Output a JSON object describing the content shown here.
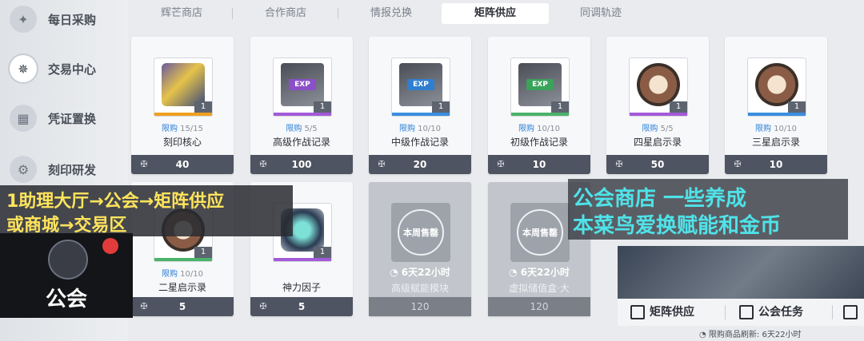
{
  "sidebar": {
    "items": [
      {
        "label": "每日采购",
        "icon": "cart-icon",
        "active": false
      },
      {
        "label": "交易中心",
        "icon": "star-compass-icon",
        "active": true
      },
      {
        "label": "凭证置换",
        "icon": "voucher-icon",
        "active": false
      },
      {
        "label": "刻印研发",
        "icon": "gear-icon",
        "active": false
      }
    ]
  },
  "tabs": [
    {
      "label": "辉芒商店",
      "active": false
    },
    {
      "label": "合作商店",
      "active": false
    },
    {
      "label": "情报兑换",
      "active": false
    },
    {
      "label": "矩阵供应",
      "active": true
    },
    {
      "label": "同调轨迹",
      "active": false
    }
  ],
  "items": [
    {
      "name": "刻印核心",
      "limit_label": "限购",
      "limit": "15/15",
      "qty": "1",
      "price": "40",
      "art": "core",
      "bar_color": "#f0a020"
    },
    {
      "name": "高级作战记录",
      "limit_label": "限购",
      "limit": "5/5",
      "qty": "1",
      "price": "100",
      "art": "exp",
      "exp_label": "EXP",
      "bar_color": "#a35ad8"
    },
    {
      "name": "中级作战记录",
      "limit_label": "限购",
      "limit": "10/10",
      "qty": "1",
      "price": "20",
      "art": "exp",
      "exp_label": "EXP",
      "bar_color": "#3a8ee0"
    },
    {
      "name": "初级作战记录",
      "limit_label": "限购",
      "limit": "10/10",
      "qty": "1",
      "price": "10",
      "art": "exp",
      "exp_label": "EXP",
      "bar_color": "#4bb36a"
    },
    {
      "name": "四星启示录",
      "limit_label": "限购",
      "limit": "5/5",
      "qty": "1",
      "price": "50",
      "art": "seal",
      "bar_color": "#a35ad8"
    },
    {
      "name": "三星启示录",
      "limit_label": "限购",
      "limit": "10/10",
      "qty": "1",
      "price": "10",
      "art": "seal",
      "bar_color": "#3a8ee0"
    },
    {
      "name": "二星启示录",
      "limit_label": "限购",
      "limit": "10/10",
      "qty": "1",
      "price": "5",
      "art": "seal",
      "bar_color": "#4bb36a"
    },
    {
      "name": "神力因子",
      "limit_label": "",
      "limit": "",
      "qty": "1",
      "price": "5",
      "art": "factor",
      "bar_color": "#a35ad8"
    },
    {
      "name": "高级赋能模块",
      "sold_out": true,
      "sold_label": "本周售罄",
      "timer": "6天22小时",
      "price": "120"
    },
    {
      "name": "虚拟储值盒·大",
      "sold_out": true,
      "sold_label": "本周售罄",
      "timer": "6天22小时",
      "price": "120"
    }
  ],
  "overlay_left": {
    "line1": "1助理大厅→公会→矩阵供应",
    "line2": "或商城→交易区"
  },
  "guild": {
    "label": "公会"
  },
  "overlay_right": {
    "line1": "公会商店  一些养成",
    "line2": "本菜鸟爱换赋能和金币"
  },
  "bottom_tabs": [
    {
      "label": "矩阵供应",
      "icon": "matrix-icon"
    },
    {
      "label": "公会任务",
      "icon": "task-icon"
    }
  ],
  "refresh": {
    "label": "限购商品刷新:",
    "time": "6天22小时"
  }
}
